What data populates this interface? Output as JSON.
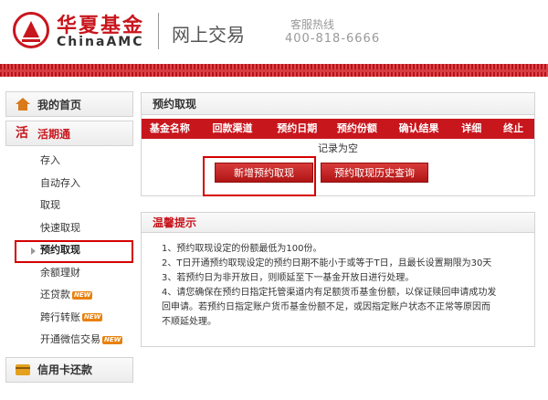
{
  "header": {
    "brand_cn": "华夏基金",
    "brand_en": "ChinaAMC",
    "section": "网上交易",
    "hotline_label": "客服热线",
    "hotline_number": "400-818-6666"
  },
  "sidebar": {
    "home": "我的首页",
    "current_deposit": "活期通",
    "items": [
      {
        "label": "存入",
        "new": false
      },
      {
        "label": "自动存入",
        "new": false
      },
      {
        "label": "取现",
        "new": false
      },
      {
        "label": "快速取现",
        "new": false
      },
      {
        "label": "预约取现",
        "new": false,
        "selected": true
      },
      {
        "label": "余额理财",
        "new": false
      },
      {
        "label": "还贷款",
        "new": true
      },
      {
        "label": "跨行转账",
        "new": true
      },
      {
        "label": "开通微信交易",
        "new": true
      }
    ],
    "new_badge": "NEW",
    "credit_card": "信用卡还款"
  },
  "main": {
    "title": "预约取现",
    "columns": [
      "基金名称",
      "回款渠道",
      "预约日期",
      "预约份额",
      "确认结果",
      "详细",
      "终止"
    ],
    "empty_text": "记录为空",
    "btn_new": "新增预约取现",
    "btn_history": "预约取现历史查询"
  },
  "tips": {
    "title": "温馨提示",
    "items": [
      "1、预约取现设定的份额最低为100份。",
      "2、T日开通预约取现设定的预约日期不能小于或等于T日，且最长设置期限为30天",
      "3、若预约日为非开放日，则顺延至下一基金开放日进行处理。",
      "4、请您确保在预约日指定托管渠道内有足额货币基金份额，以保证赎回申请成功发",
      "回申请。若预约日指定账户货币基金份额不足，或因指定账户状态不正常等原因而",
      "不顺延处理。"
    ]
  },
  "colors": {
    "brand_red": "#c8161d",
    "highlight_red": "#d40000"
  }
}
